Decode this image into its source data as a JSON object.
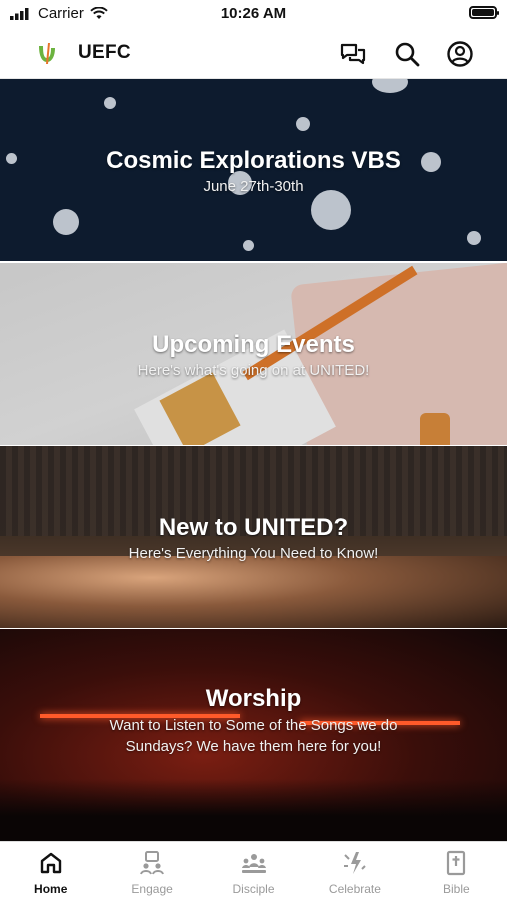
{
  "status_bar": {
    "carrier": "Carrier",
    "time": "10:26 AM"
  },
  "header": {
    "brand": "UEFC",
    "icons": [
      "chat-bubbles-icon",
      "search-icon",
      "account-icon"
    ]
  },
  "banners": [
    {
      "title": "Cosmic Explorations VBS",
      "subtitle": "June 27th-30th"
    },
    {
      "title": "Upcoming Events",
      "subtitle": "Here's what's going on at UNITED!"
    },
    {
      "title": "New to UNITED?",
      "subtitle": "Here's Everything You Need to Know!"
    },
    {
      "title": "Worship",
      "subtitle_line1": "Want to Listen to Some of the Songs we do",
      "subtitle_line2": "Sundays? We have them here for you!"
    }
  ],
  "tabs": [
    {
      "label": "Home",
      "active": true
    },
    {
      "label": "Engage",
      "active": false
    },
    {
      "label": "Disciple",
      "active": false
    },
    {
      "label": "Celebrate",
      "active": false
    },
    {
      "label": "Bible",
      "active": false
    }
  ],
  "colors": {
    "active_tab": "#111111",
    "inactive_tab": "#9a9a9a",
    "logo_green": "#6cb33f",
    "logo_orange": "#e8742a"
  }
}
